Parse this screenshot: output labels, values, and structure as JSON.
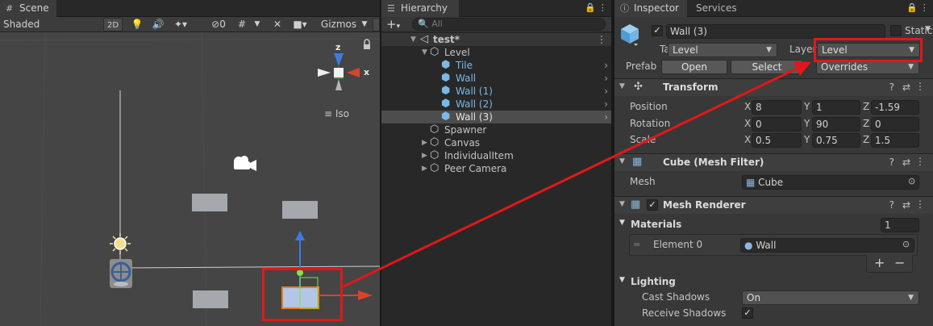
{
  "scene": {
    "tab_label": "Scene",
    "shading_mode": "Shaded",
    "btn_2d": "2D",
    "hidden_count": "0",
    "gizmos_label": "Gizmos",
    "iso_label": "Iso",
    "axis_z": "z",
    "axis_x": "x"
  },
  "hierarchy": {
    "tab_label": "Hierarchy",
    "search_placeholder": "All",
    "items": [
      {
        "label": "test*"
      },
      {
        "label": "Level"
      },
      {
        "label": "Tile"
      },
      {
        "label": "Wall"
      },
      {
        "label": "Wall (1)"
      },
      {
        "label": "Wall (2)"
      },
      {
        "label": "Wall (3)"
      },
      {
        "label": "Spawner"
      },
      {
        "label": "Canvas"
      },
      {
        "label": "IndividualItem"
      },
      {
        "label": "Peer Camera"
      }
    ]
  },
  "inspector": {
    "tab_label": "Inspector",
    "services_tab": "Services",
    "object_name": "Wall (3)",
    "static_label": "Static",
    "tag_label": "Tag",
    "tag_value": "Level",
    "layer_label": "Layer",
    "layer_value": "Level",
    "prefab_label": "Prefab",
    "open_label": "Open",
    "select_label": "Select",
    "overrides_label": "Overrides",
    "transform": {
      "title": "Transform",
      "position_label": "Position",
      "rotation_label": "Rotation",
      "scale_label": "Scale",
      "x": "X",
      "y": "Y",
      "z": "Z",
      "position": {
        "x": "8",
        "y": "1",
        "z": "-1.59"
      },
      "rotation": {
        "x": "0",
        "y": "90",
        "z": "0"
      },
      "scale": {
        "x": "0.5",
        "y": "0.75",
        "z": "1.5"
      }
    },
    "mesh_filter": {
      "title": "Cube (Mesh Filter)",
      "mesh_label": "Mesh",
      "mesh_value": "Cube"
    },
    "mesh_renderer": {
      "title": "Mesh Renderer",
      "materials_label": "Materials",
      "materials_count": "1",
      "element0_label": "Element 0",
      "element0_value": "Wall",
      "lighting_label": "Lighting",
      "cast_shadows_label": "Cast Shadows",
      "cast_shadows_value": "On",
      "receive_shadows_label": "Receive Shadows",
      "plus": "+",
      "minus": "−"
    }
  },
  "colors": {
    "highlight_red": "#e01818",
    "selection_blue": "#7ab8e8",
    "panel_bg": "#383838"
  }
}
